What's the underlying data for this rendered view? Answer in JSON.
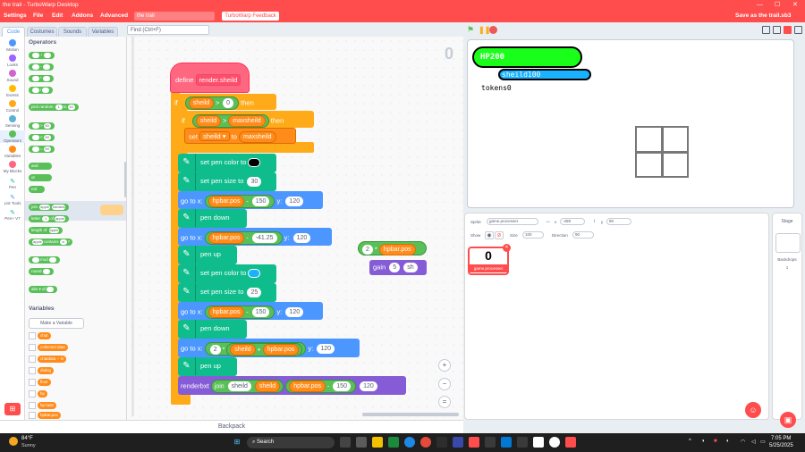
{
  "window": {
    "title": "the trail - TurboWarp Desktop",
    "minimize": "—",
    "maximize": "☐",
    "close": "✕"
  },
  "menu": {
    "settings": "Settings",
    "file": "File",
    "edit": "Edit",
    "addons": "Addons",
    "advanced": "Advanced",
    "project_title": "the trail",
    "feedback": "TurboWarp Feedback",
    "save": "Save as the trail.sb3"
  },
  "tabs": {
    "code": "Code",
    "costumes": "Costumes",
    "sounds": "Sounds",
    "variables": "Variables"
  },
  "find": {
    "placeholder": "Find (Ctrl+F)"
  },
  "categories": [
    {
      "label": "Motion",
      "color": "#4c97ff"
    },
    {
      "label": "Looks",
      "color": "#9966ff"
    },
    {
      "label": "Sound",
      "color": "#cf63cf"
    },
    {
      "label": "Events",
      "color": "#ffbf00"
    },
    {
      "label": "Control",
      "color": "#ffab19"
    },
    {
      "label": "Sensing",
      "color": "#5cb1d6"
    },
    {
      "label": "Operators",
      "color": "#59c059"
    },
    {
      "label": "Variables",
      "color": "#ff8c1a"
    },
    {
      "label": "My Blocks",
      "color": "#ff6680"
    },
    {
      "label": "Pen",
      "color": "#0fbd8c"
    },
    {
      "label": "List Tools",
      "color": "#4c97ff"
    },
    {
      "label": "Pen+ V7",
      "color": "#0fbd8c"
    }
  ],
  "palette": {
    "operators_title": "Operators",
    "ops": [
      "+",
      "-",
      "*",
      "/"
    ],
    "pick_random": "pick random",
    "pick_from": "1",
    "to": "to",
    "pick_to": "10",
    "gt": ">",
    "lt": "<",
    "eq": "=",
    "cmp_val": "50",
    "and": "and",
    "or": "or",
    "not": "not",
    "join": "join",
    "apple": "apple",
    "banana": "banana",
    "letter": "letter",
    "letter_n": "1",
    "of": "of",
    "length_of": "length of",
    "contains": "contains",
    "contains_q": "?",
    "a": "a",
    "mod": "mod",
    "round": "round",
    "abs": "abs",
    "of2": "of",
    "variables_title": "Variables",
    "make_variable": "Make a Variable",
    "vars": [
      "chat",
      "collected data",
      "chatdata -- lv",
      "dialog",
      "floor",
      "hp",
      "hp fade",
      "hpbar.pos"
    ]
  },
  "script": {
    "define": "define",
    "define_name": "render.sheild",
    "if": "if",
    "then": "then",
    "sheild": "sheild",
    "maxsheild": "maxsheild",
    "gt": ">",
    "zero": "0",
    "set": "set",
    "to": "to",
    "set_pen_color": "set pen color to",
    "set_pen_size": "set pen size to",
    "size30": "30",
    "size25": "25",
    "go_to_x": "go to x:",
    "y": "y:",
    "hpbar_pos": "hpbar.pos",
    "minus": "-",
    "plus": "+",
    "times": "*",
    "x150": "150",
    "y120": "120",
    "x41": "-41.25",
    "pen_down": "pen down",
    "pen_up": "pen up",
    "two": "2",
    "renderbxt": "renderbxt",
    "join": "join"
  },
  "loose": {
    "two": "2",
    "times": "*",
    "hpbar_pos": "hpbar.pos",
    "gain": "gain",
    "five": "5",
    "sh": "sh"
  },
  "workspace": {
    "counter": "0",
    "zoom_in": "+",
    "zoom_out": "−",
    "reset": "="
  },
  "backpack": {
    "label": "Backpack"
  },
  "stage": {
    "hp_label": "HP200",
    "sheild_label": "sheild100",
    "tokens": "tokens0"
  },
  "sprite": {
    "label_sprite": "Sprite",
    "name": "game.processer",
    "x_label": "x",
    "x": "-289",
    "y_label": "y",
    "y": "90",
    "show": "Show",
    "size_label": "Size",
    "size": "100",
    "direction_label": "Direction",
    "direction": "90",
    "thumb_label": "game.processer",
    "thumb_costume": "0"
  },
  "stagepane": {
    "title": "Stage",
    "backdrops": "Backdrops",
    "count": "1"
  },
  "taskbar": {
    "temp": "84°F",
    "weather": "Sunny",
    "search": "Search",
    "time": "7:05 PM",
    "date": "5/25/2025"
  }
}
